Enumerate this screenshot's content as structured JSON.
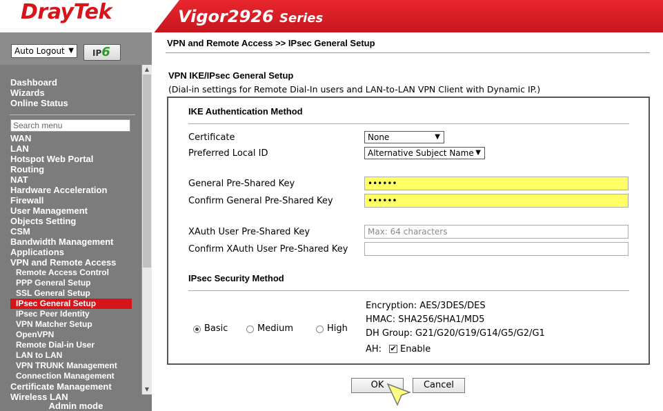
{
  "header": {
    "brand": "DrayTek",
    "model": "Vigor2926",
    "series": "Series"
  },
  "sidebar": {
    "auto_logout": "Auto Logout",
    "ipv6_label": "IP",
    "ipv6_digit": "6",
    "top_items": [
      "Dashboard",
      "Wizards",
      "Online Status"
    ],
    "search_placeholder": "Search menu",
    "items": [
      "WAN",
      "LAN",
      "Hotspot Web Portal",
      "Routing",
      "NAT",
      "Hardware Acceleration",
      "Firewall",
      "User Management",
      "Objects Setting",
      "CSM",
      "Bandwidth Management",
      "Applications",
      "VPN and Remote Access"
    ],
    "subitems": [
      "Remote Access Control",
      "PPP General Setup",
      "SSL General Setup",
      "IPsec General Setup",
      "IPsec Peer Identity",
      "VPN Matcher Setup",
      "OpenVPN",
      "Remote Dial-in User",
      "LAN to LAN",
      "VPN TRUNK Management",
      "Connection Management"
    ],
    "after_items": [
      "Certificate Management",
      "Wireless LAN"
    ],
    "admin_mode": "Admin mode"
  },
  "main": {
    "breadcrumb": "VPN and Remote Access >> IPsec General Setup",
    "section_title": "VPN IKE/IPsec General Setup",
    "section_sub": "(Dial-in settings for Remote Dial-In users and LAN-to-LAN VPN Client with Dynamic IP.)",
    "ike_title": "IKE Authentication Method",
    "certificate_label": "Certificate",
    "certificate_value": "None",
    "local_id_label": "Preferred Local ID",
    "local_id_value": "Alternative Subject Name",
    "psk_label": "General Pre-Shared Key",
    "psk_value": "••••••",
    "psk_confirm_label": "Confirm General Pre-Shared Key",
    "psk_confirm_value": "••••••",
    "xauth_label": "XAuth User Pre-Shared Key",
    "xauth_placeholder": "Max: 64 characters",
    "xauth_confirm_label": "Confirm XAuth User Pre-Shared Key",
    "ipsec_title": "IPsec Security Method",
    "radio_basic": "Basic",
    "radio_medium": "Medium",
    "radio_high": "High",
    "encryption": "Encryption: AES/3DES/DES",
    "hmac": "HMAC: SHA256/SHA1/MD5",
    "dh_group": "DH Group: G21/G20/G19/G14/G5/G2/G1",
    "ah_label": "AH:",
    "ah_enable": "Enable",
    "ok_button": "OK",
    "cancel_button": "Cancel"
  },
  "colors": {
    "brand_red": "#d7141a",
    "sidebar": "#7c7c7c",
    "highlight": "#ffff66"
  }
}
